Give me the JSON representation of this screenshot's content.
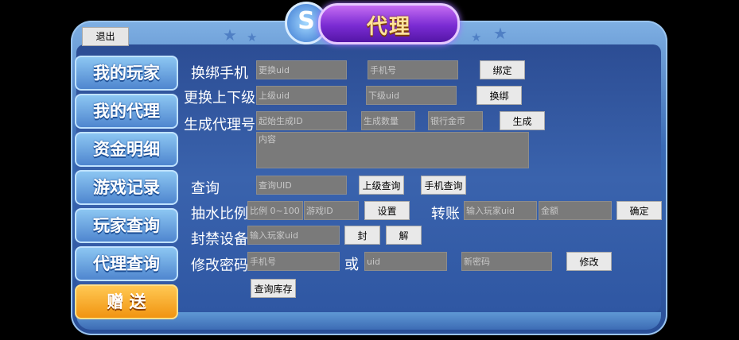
{
  "header": {
    "title": "代理",
    "badge": "S"
  },
  "exit_label": "退出",
  "menu": [
    {
      "label": "我的玩家"
    },
    {
      "label": "我的代理"
    },
    {
      "label": "资金明细"
    },
    {
      "label": "游戏记录"
    },
    {
      "label": "玩家查询"
    },
    {
      "label": "代理查询"
    },
    {
      "label": "赠 送"
    }
  ],
  "form": {
    "bind_phone": {
      "label": "换绑手机",
      "uid_placeholder": "更换uid",
      "phone_placeholder": "手机号",
      "button": "绑定"
    },
    "change_parent": {
      "label": "更换上下级",
      "upper_placeholder": "上级uid",
      "lower_placeholder": "下级uid",
      "button": "换绑"
    },
    "gen_agent": {
      "label": "生成代理号",
      "start_placeholder": "起始生成ID",
      "count_placeholder": "生成数量",
      "gold_placeholder": "银行金币",
      "button": "生成"
    },
    "content_placeholder": "内容",
    "query": {
      "label": "查询",
      "uid_placeholder": "查询UID",
      "upper_button": "上级查询",
      "phone_button": "手机查询"
    },
    "rake": {
      "label": "抽水比例",
      "ratio_placeholder": "比例 0~100",
      "game_placeholder": "游戏ID",
      "button": "设置"
    },
    "transfer": {
      "label": "转账",
      "uid_placeholder": "输入玩家uid",
      "amount_placeholder": "金额",
      "button": "确定"
    },
    "ban": {
      "label": "封禁设备",
      "uid_placeholder": "输入玩家uid",
      "ban_button": "封",
      "unban_button": "解"
    },
    "password": {
      "label": "修改密码",
      "phone_placeholder": "手机号",
      "or_label": "或",
      "uid_placeholder": "uid",
      "new_placeholder": "新密码",
      "button": "修改"
    },
    "stock_button": "查询库存"
  }
}
